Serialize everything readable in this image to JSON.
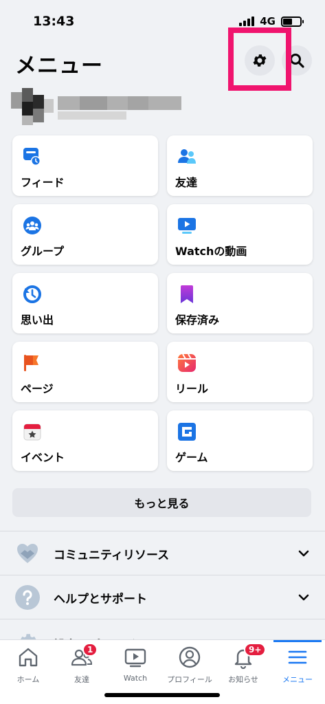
{
  "status": {
    "time": "13:43",
    "network": "4G",
    "battery_level": 0.55
  },
  "header": {
    "title": "メニュー"
  },
  "shortcuts": [
    {
      "label": "フィード",
      "icon": "feed-icon"
    },
    {
      "label": "友達",
      "icon": "friends-icon"
    },
    {
      "label": "グループ",
      "icon": "groups-icon"
    },
    {
      "label": "Watchの動画",
      "icon": "watch-video-icon"
    },
    {
      "label": "思い出",
      "icon": "memories-icon"
    },
    {
      "label": "保存済み",
      "icon": "saved-icon"
    },
    {
      "label": "ページ",
      "icon": "pages-flag-icon"
    },
    {
      "label": "リール",
      "icon": "reels-icon"
    },
    {
      "label": "イベント",
      "icon": "events-icon"
    },
    {
      "label": "ゲーム",
      "icon": "gaming-icon"
    }
  ],
  "more_button": {
    "label": "もっと見る"
  },
  "sections": [
    {
      "label": "コミュニティリソース",
      "icon": "handshake-icon"
    },
    {
      "label": "ヘルプとサポート",
      "icon": "help-icon"
    },
    {
      "label": "設定とプライバシー",
      "icon": "settings-gear-icon"
    }
  ],
  "tabs": [
    {
      "label": "ホーム",
      "icon": "home-icon"
    },
    {
      "label": "友達",
      "icon": "friends-tab-icon",
      "badge": "1"
    },
    {
      "label": "Watch",
      "icon": "watch-tab-icon"
    },
    {
      "label": "プロフィール",
      "icon": "profile-tab-icon"
    },
    {
      "label": "お知らせ",
      "icon": "bell-icon",
      "badge": "9+"
    },
    {
      "label": "メニュー",
      "icon": "menu-icon",
      "active": true
    }
  ],
  "colors": {
    "accent": "#1877f2",
    "highlight": "#f0146e",
    "badge": "#e41e3f"
  }
}
